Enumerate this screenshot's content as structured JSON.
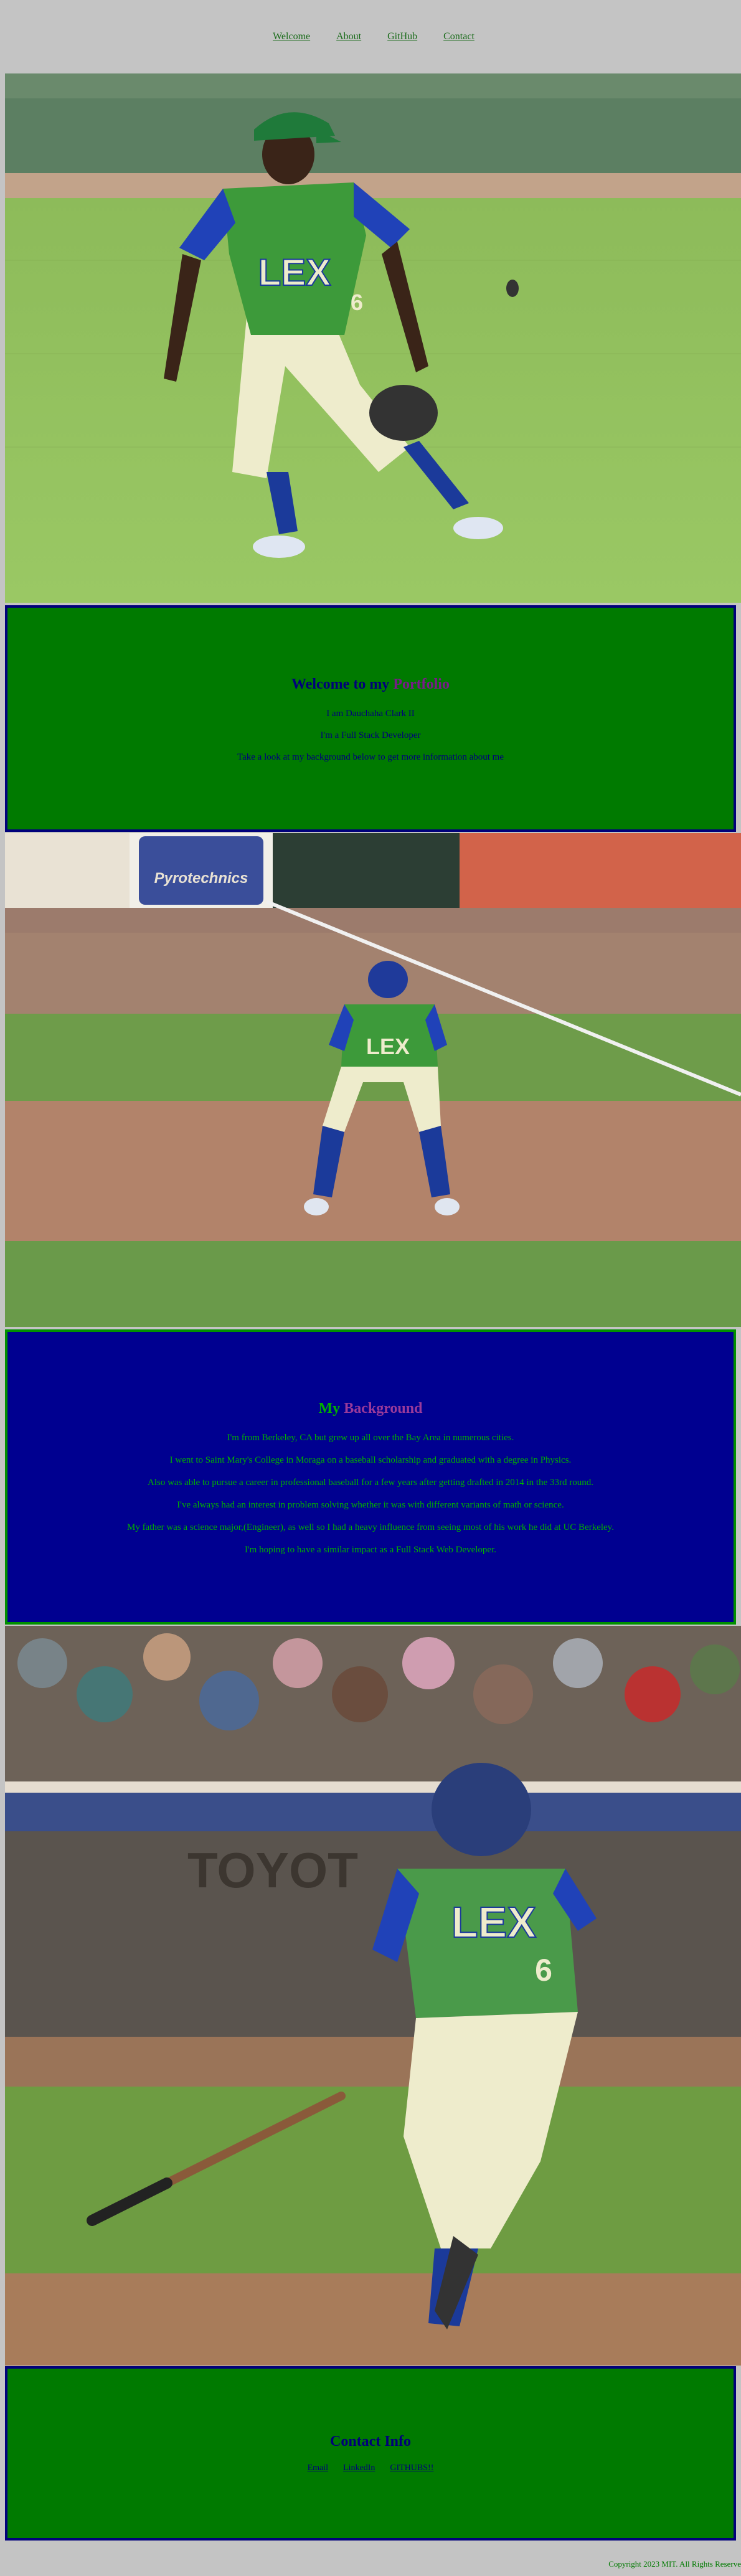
{
  "nav": {
    "links": [
      "Welcome",
      "About",
      "GitHub",
      "Contact"
    ]
  },
  "welcome": {
    "title_main": "Welcome to my",
    "title_accent": "Portfolio",
    "lines": [
      "I am Dauchaha Clark II",
      "I'm a Full Stack Developer",
      "Take a look at my background below to get more information about me"
    ]
  },
  "background": {
    "title_main": "My",
    "title_accent": "Background",
    "lines": [
      "I'm from Berkeley, CA but grew up all over the Bay Area in numerous cities.",
      "I went to Saint Mary's College in Moraga on a baseball scholarship and graduated with a degree in Physics.",
      "Also was able to pursue a career in professional baseball for a few years after getting drafted in 2014 in the 33rd round.",
      "I've always had an interest in problem solving whether it was with different variants of math or science.",
      "My father was a science major,(Engineer), as well so I had a heavy influence from seeing most of his work he did at UC Berkeley.",
      "I'm hoping to have a similar impact as a Full Stack Web Developer."
    ]
  },
  "contact": {
    "title": "Contact  Info",
    "links": [
      "Email",
      "LinkedIn",
      "GITHUBS!!"
    ]
  },
  "footer": {
    "text": "Copyright 2023 MIT. All Rights Reserve"
  },
  "photos": {
    "jersey_text": "LEX",
    "jersey_number": "6",
    "ad_text": "Pyrotechnics",
    "stadium_text": "TOYOT"
  }
}
